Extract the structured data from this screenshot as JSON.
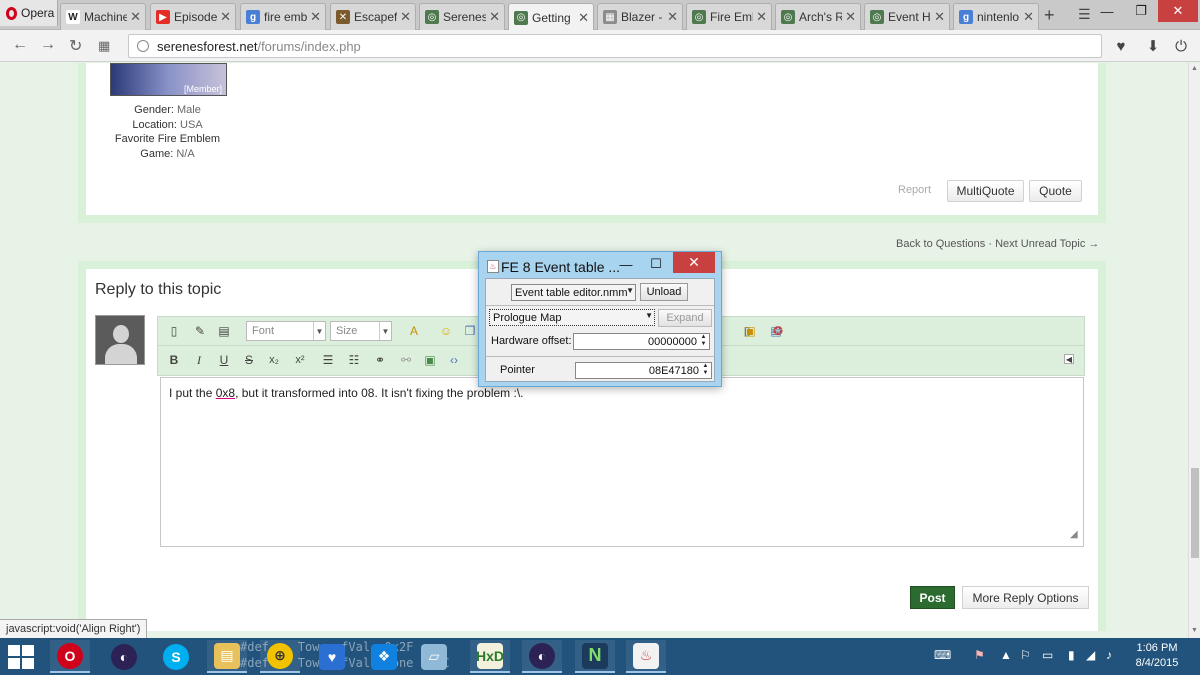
{
  "browser": {
    "brand": "Opera",
    "tabs": [
      {
        "label": "Machine",
        "icon": "wikipedia-icon",
        "fav": "W",
        "color": "#ffffff"
      },
      {
        "label": "Episode",
        "icon": "youtube-icon",
        "fav": "▶",
        "color": "#e52d27"
      },
      {
        "label": "fire emb",
        "icon": "google-icon",
        "fav": "g",
        "color": "#4a7fd6"
      },
      {
        "label": "Escapef",
        "icon": "sword-icon",
        "fav": "✕",
        "color": "#7b5a2e"
      },
      {
        "label": "Serenes",
        "icon": "serenes-icon",
        "fav": "◎",
        "color": "#4f7a4f"
      },
      {
        "label": "Getting",
        "icon": "serenes-icon",
        "fav": "◎",
        "color": "#4f7a4f"
      },
      {
        "label": "Blazer -",
        "icon": "blazer-icon",
        "fav": "▦",
        "color": "#8c8c8c"
      },
      {
        "label": "Fire Eml",
        "icon": "serenes-icon",
        "fav": "◎",
        "color": "#4f7a4f"
      },
      {
        "label": "Arch's R",
        "icon": "serenes-icon",
        "fav": "◎",
        "color": "#4f7a4f"
      },
      {
        "label": "Event H",
        "icon": "serenes-icon",
        "fav": "◎",
        "color": "#4f7a4f"
      },
      {
        "label": "nintenlo",
        "icon": "google-icon",
        "fav": "g",
        "color": "#4a7fd6"
      }
    ],
    "url_host": "serenesforest.net",
    "url_path": "/forums/index.php"
  },
  "profile": {
    "avatar_caption": "[Member]",
    "gender_label": "Gender:",
    "gender_value": "Male",
    "location_label": "Location:",
    "location_value": "USA",
    "fav_label_1": "Favorite Fire Emblem",
    "fav_label_2": "Game:",
    "fav_value": "N/A"
  },
  "post_actions": {
    "report": "Report",
    "multiquote": "MultiQuote",
    "quote": "Quote"
  },
  "nav_links": {
    "back": "Back to Questions",
    "sep": "·",
    "next": "Next Unread Topic →"
  },
  "reply": {
    "title": "Reply to this topic",
    "font_placeholder": "Font",
    "size_placeholder": "Size",
    "text_before": "I put the ",
    "text_underlined": "0x8",
    "text_after": ", but it transformed into 08. It isn't fixing the problem :\\.",
    "post_button": "Post",
    "more_button": "More Reply Options"
  },
  "status_url": "javascript:void('Align Right')",
  "dialog": {
    "title": "FE 8 Event table ...",
    "module_select": "Event table editor.nmm",
    "unload": "Unload",
    "map_select": "Prologue Map",
    "expand": "Expand",
    "hw_label": "Hardware offset:",
    "hw_value": "00000000",
    "pointer_label": "Pointer",
    "pointer_value": "08E47180"
  },
  "taskbar": {
    "peek_line1": "#def    TowerofVal  0x2F",
    "peek_line2": "#def    TowerofVal Clone 0x2C",
    "time": "1:06 PM",
    "date": "8/4/2015"
  },
  "colors": {
    "page_bg": "#e8f3e8",
    "post_green": "#2c6b2f",
    "taskbar": "#22537c",
    "dialog_frame": "#a9d4f0"
  }
}
